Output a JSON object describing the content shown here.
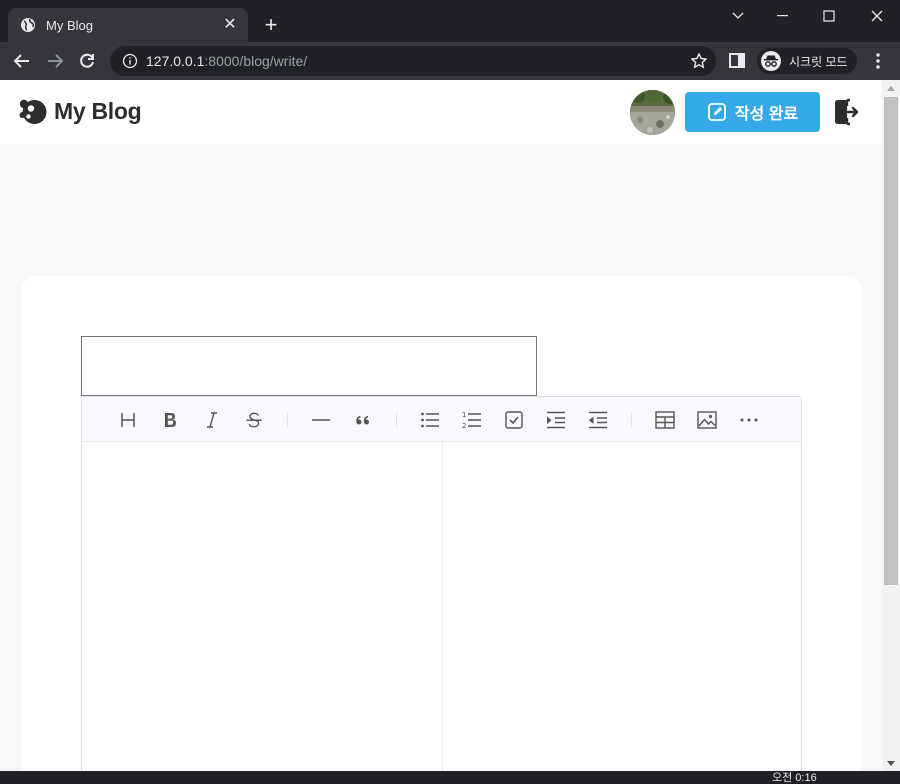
{
  "browser": {
    "tab_title": "My Blog",
    "tab_close": "✕",
    "new_tab": "+",
    "url_host": "127.0.0.1",
    "url_path": ":8000/blog/write/",
    "incognito_label": "시크릿 모드"
  },
  "header": {
    "logo_text": "My Blog",
    "submit_label": "작성 완료"
  },
  "editor": {
    "title_value": "",
    "toolbar": [
      "heading-icon",
      "bold-icon",
      "italic-icon",
      "strike-icon",
      "hr-icon",
      "quote-icon",
      "bullet-list-icon",
      "ordered-list-icon",
      "task-list-icon",
      "indent-icon",
      "outdent-icon",
      "table-icon",
      "image-icon",
      "more-icon"
    ]
  },
  "system": {
    "clock": "오전 0:16"
  },
  "colors": {
    "accent": "#35a8e8",
    "chrome_dark": "#202124",
    "chrome_tab": "#35363a"
  }
}
